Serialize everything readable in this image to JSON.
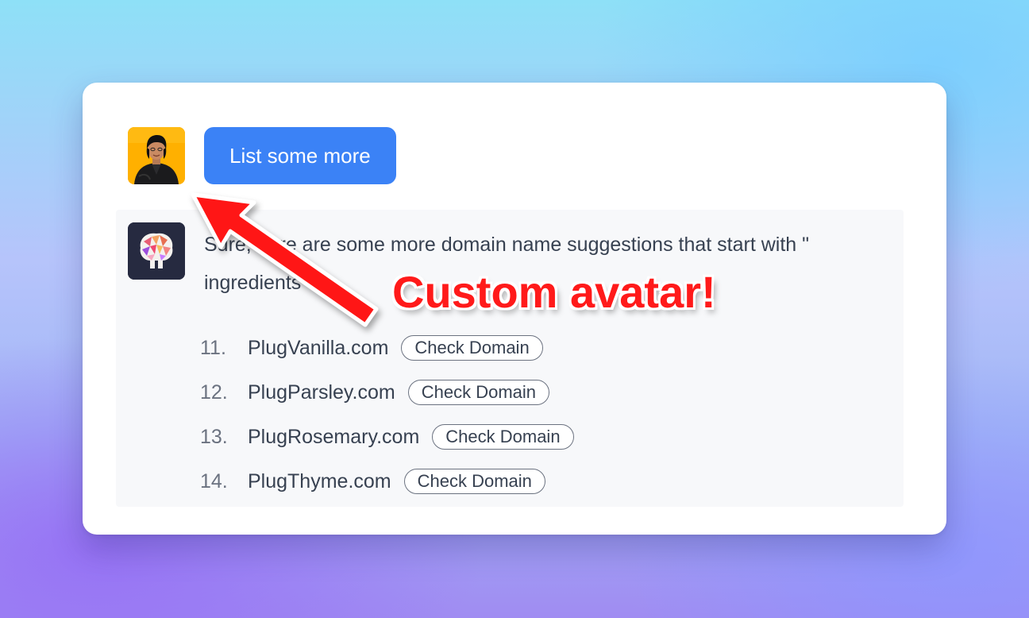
{
  "conversation": {
    "user_message": "List some more",
    "bot_message": {
      "line1": "Sure, here are some more domain name suggestions that start with \"",
      "line2": "ingredients"
    },
    "suggestions": [
      {
        "number": "11.",
        "domain": "PlugVanilla.com",
        "action_label": "Check Domain"
      },
      {
        "number": "12.",
        "domain": "PlugParsley.com",
        "action_label": "Check Domain"
      },
      {
        "number": "13.",
        "domain": "PlugRosemary.com",
        "action_label": "Check Domain"
      },
      {
        "number": "14.",
        "domain": "PlugThyme.com",
        "action_label": "Check Domain"
      }
    ]
  },
  "annotation": {
    "callout_text": "Custom avatar!",
    "color": "#ff1a1a"
  },
  "colors": {
    "user_bubble": "#3b82f6",
    "bot_background": "#f7f8fa"
  },
  "icons": {
    "user_avatar": "user-photo-avatar",
    "bot_avatar": "brain-logo-avatar",
    "arrow": "red-arrow"
  }
}
